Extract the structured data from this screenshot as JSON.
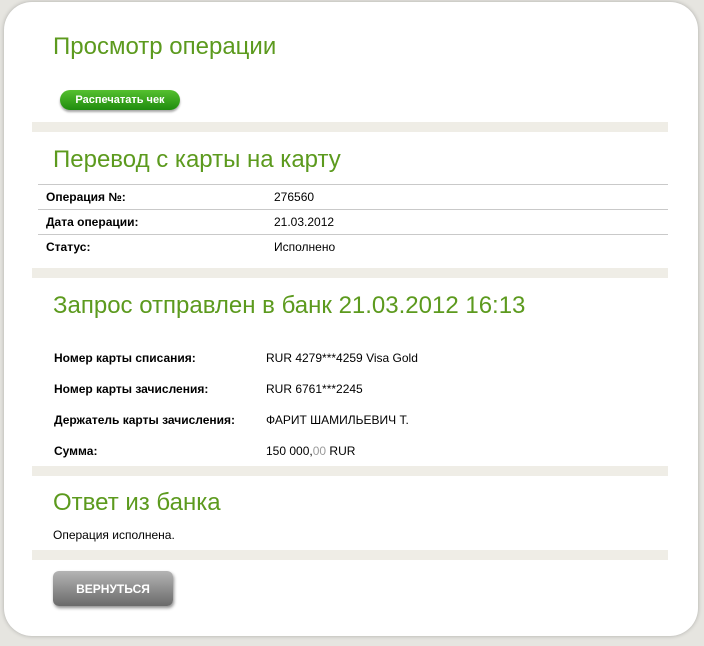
{
  "page": {
    "title": "Просмотр операции",
    "print_label": "Распечатать чек",
    "back_label": "ВЕРНУТЬСЯ"
  },
  "transfer": {
    "title": "Перевод с карты на карту",
    "rows": [
      {
        "label": "Операция №:",
        "value": "276560"
      },
      {
        "label": "Дата операции:",
        "value": "21.03.2012"
      },
      {
        "label": "Статус:",
        "value": "Исполнено"
      }
    ]
  },
  "request": {
    "title": "Запрос отправлен в банк 21.03.2012 16:13",
    "rows": [
      {
        "label": "Номер карты списания:",
        "value": "RUR 4279***4259 Visa Gold"
      },
      {
        "label": "Номер карты зачисления:",
        "value": "RUR 6761***2245"
      },
      {
        "label": "Держатель карты зачисления:",
        "value": "ФАРИТ ШАМИЛЬЕВИЧ Т."
      }
    ],
    "amount_label": "Сумма:",
    "amount_main": "150 000,",
    "amount_decimals": "00",
    "amount_currency": "RUR"
  },
  "response": {
    "title": "Ответ из банка",
    "text": "Операция исполнена."
  }
}
